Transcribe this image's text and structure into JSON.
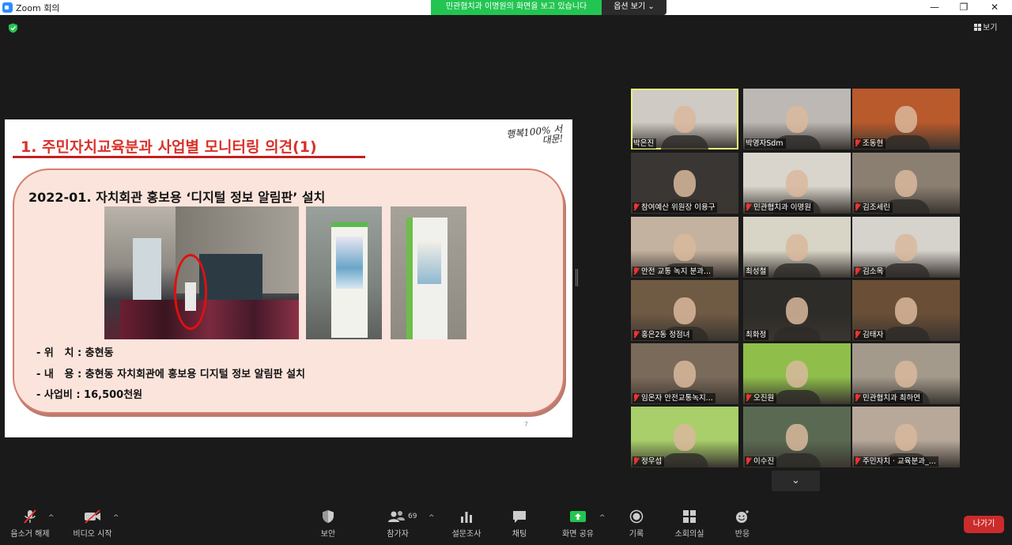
{
  "window": {
    "title": "Zoom 회의",
    "share_banner": "민관협치과 이명원의 화면을 보고 있습니다",
    "view_options": "옵션 보기 ⌄",
    "minimize": "—",
    "maximize": "❐",
    "close": "✕"
  },
  "view_button": "보기",
  "slide": {
    "title": "1. 주민자치교육분과 사업별 모니터링 의견(1)",
    "logo_text": "행복100% 서대문!",
    "heading": "2022-01. 자치회관 홍보용  ‘디지털 정보 알림판’  설치",
    "bullets": [
      "- 위   치 : 충현동",
      "- 내   용 : 충현동 자치회관에 홍보용 디지털 정보 알림판 설치",
      "- 사업비 : 16,500천원"
    ],
    "page_number": "7"
  },
  "participants": [
    {
      "name": "박은진",
      "muted": false,
      "active": true,
      "bg": "#cfcac4"
    },
    {
      "name": "박영자Sdm",
      "muted": false,
      "active": false,
      "bg": "#bdb8b4"
    },
    {
      "name": "조동현",
      "muted": true,
      "active": false,
      "bg": "#b85a2c"
    },
    {
      "name": "참여예산 위원장 이용구",
      "muted": true,
      "active": false,
      "bg": "#3a3634"
    },
    {
      "name": "민관협치과 이명원",
      "muted": true,
      "active": false,
      "bg": "#d9d5cc"
    },
    {
      "name": "김조세린",
      "muted": true,
      "active": false,
      "bg": "#8b7f72"
    },
    {
      "name": "안전 교통 녹지 분과...",
      "muted": true,
      "active": false,
      "bg": "#c3b2a0"
    },
    {
      "name": "최성철",
      "muted": false,
      "active": false,
      "bg": "#d8d4c6"
    },
    {
      "name": "김소옥",
      "muted": true,
      "active": false,
      "bg": "#d6d2cc"
    },
    {
      "name": "홍은2동 정점녀",
      "muted": true,
      "active": false,
      "bg": "#6f5a44"
    },
    {
      "name": "최화정",
      "muted": false,
      "active": false,
      "bg": "#2e2c28"
    },
    {
      "name": "김태자",
      "muted": true,
      "active": false,
      "bg": "#6a4e36"
    },
    {
      "name": "임온자 안전교통녹지...",
      "muted": true,
      "active": false,
      "bg": "#7a6a5a"
    },
    {
      "name": "오진원",
      "muted": true,
      "active": false,
      "bg": "#8fbf4a"
    },
    {
      "name": "민관협치과 최하연",
      "muted": true,
      "active": false,
      "bg": "#a49a8c"
    },
    {
      "name": "정우섭",
      "muted": true,
      "active": false,
      "bg": "#a8cf6a"
    },
    {
      "name": "이수진",
      "muted": true,
      "active": false,
      "bg": "#5a6a52"
    },
    {
      "name": "주민자치 · 교육분과_...",
      "muted": true,
      "active": false,
      "bg": "#b7a89a"
    }
  ],
  "scroll_down": "⌄",
  "toolbar": {
    "unmute": "음소거 해제",
    "start_video": "비디오 시작",
    "security": "보안",
    "participants": "참가자",
    "participants_count": "69",
    "polls": "설문조사",
    "chat": "채팅",
    "share_screen": "화면 공유",
    "record": "기록",
    "breakout": "소회의실",
    "reactions": "반응",
    "leave": "나가기",
    "caret": "^"
  },
  "colors": {
    "banner": "#23c552",
    "slide_title": "#d8322b",
    "leave": "#cc2b2b",
    "share_icon": "#23c552",
    "active_speaker": "#e6f27a"
  }
}
